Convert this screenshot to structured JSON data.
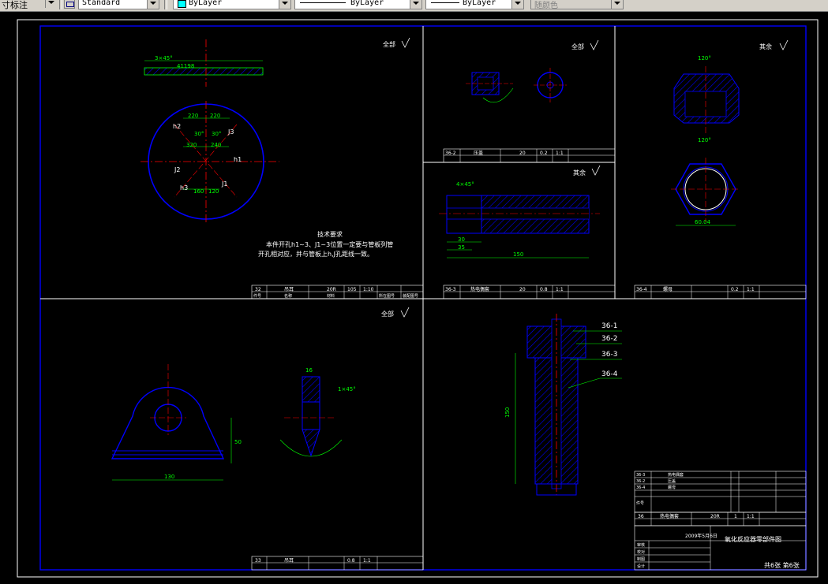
{
  "toolbar": {
    "dimstyle_label": "寸标注",
    "text_style": "Standard",
    "layer": "ByLayer",
    "linetype": "ByLayer",
    "lineweight": "ByLayer",
    "plot_style": "随颜色"
  },
  "colors": {
    "background": "#000000",
    "border": "#0000ff",
    "hatch": "#0000ff",
    "dimension": "#00ff00",
    "center": "#ff0000",
    "text": "#ffffff",
    "leader": "#00ff00"
  },
  "sheet": {
    "title": "氧化反应器零部件图",
    "date": "2009年5月6日",
    "sheet_of": "共6张 第6张",
    "part32": {
      "no": "32",
      "name": "吊耳",
      "material": "20R",
      "weight": "105",
      "scale": "1:10"
    },
    "part33": {
      "no": "33",
      "name": "吊耳",
      "material": "",
      "weight": "0.8",
      "scale": "1:1"
    },
    "part36_2": {
      "no": "36-2",
      "name": "压盖",
      "material": "20",
      "weight": "0.2",
      "scale": "1:1"
    },
    "part36_3": {
      "no": "36-3",
      "name": "热电偶套",
      "material": "20",
      "weight": "0.8",
      "scale": "1:1"
    },
    "part36_4": {
      "no": "36-4",
      "name": "螺母",
      "material": "",
      "weight": "0.2",
      "scale": "1:1"
    },
    "part36": {
      "no": "36",
      "name": "热电偶套",
      "material": "20R",
      "weight": "1",
      "scale": "1:1"
    }
  },
  "labels": {
    "roughness_all": "全部",
    "roughness_rest": "其余",
    "tech_req_title": "技术要求",
    "tech_req_line1": "本件开孔h1~3、J1~3位置一定要与管板列管",
    "tech_req_line2": "开孔相对应，并与管板上h,J孔距线一致。",
    "h1": "h1",
    "h2": "h2",
    "h3": "h3",
    "j1": "J1",
    "j2": "J2",
    "j3": "J3",
    "dim_41198": "41198",
    "dim_3x45": "3×45°",
    "dim_220a": "220",
    "dim_220b": "220",
    "dim_320": "320",
    "dim_240": "240",
    "dim_30a": "30°",
    "dim_30b": "30°",
    "dim_160": "160",
    "dim_120": "120",
    "dim_4x45": "4×45°",
    "dim_30x": "30",
    "dim_35": "35",
    "dim_150": "150",
    "dim_120deg": "120°",
    "dim_60_04": "60.04",
    "dim_1x45": "1×45°",
    "dim_16": "16",
    "dim_130": "130",
    "dim_50": "50",
    "dim_150v": "150",
    "ref_36_1": "36-1",
    "ref_36_2": "36-2",
    "ref_36_3": "36-3",
    "ref_36_4": "36-4",
    "hdr_seq": "件号",
    "hdr_name": "名称",
    "hdr_material": "材料",
    "hdr_weight": "重量",
    "hdr_scale": "比例",
    "hdr_drawing": "所在图号",
    "hdr_assembly": "装配图号",
    "approver_1": "审核",
    "approver_2": "设计",
    "approver_3": "校对",
    "approver_4": "制图"
  }
}
